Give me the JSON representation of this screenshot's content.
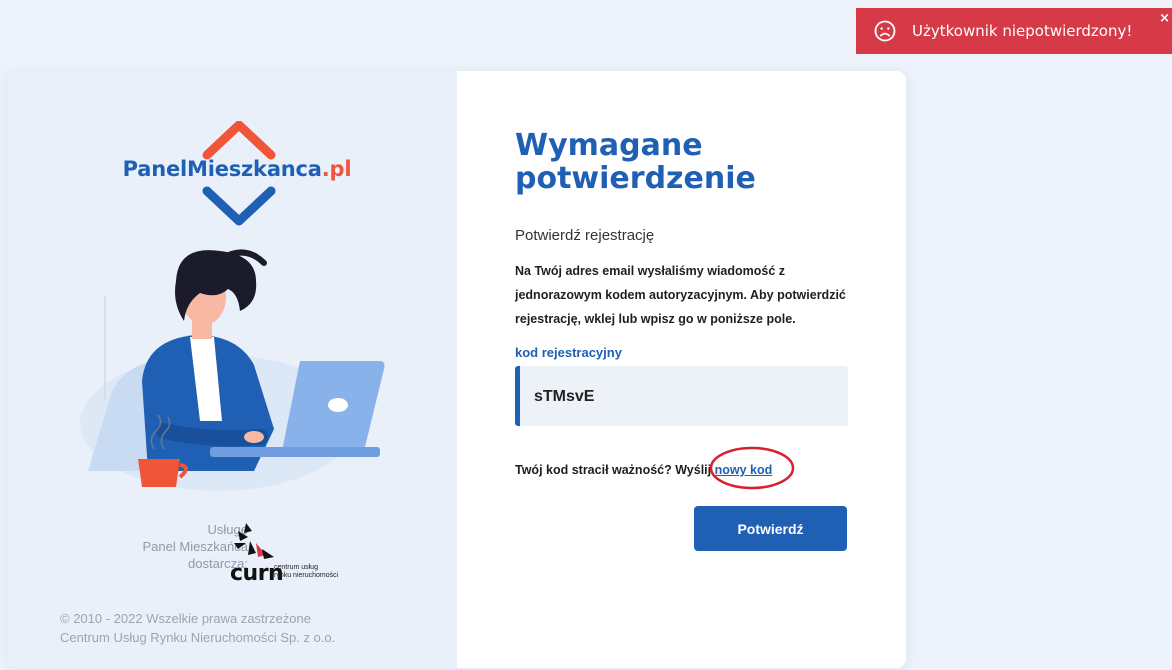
{
  "toast": {
    "message": "Użytkownik niepotwierdzony!",
    "close_symbol": "×",
    "icon": "sad-face-icon",
    "color": "#d63a47"
  },
  "brand": {
    "logo_main": "PanelMieszkanca",
    "logo_suffix": ".pl",
    "primary_color": "#1f5fb4",
    "accent_color": "#f0553a"
  },
  "credits": {
    "line1": "Usługę",
    "line2": "Panel Mieszkańca",
    "line3": "dostarcza:",
    "provider_logo": "curn",
    "provider_sub1": "centrum usług",
    "provider_sub2": "rynku nieruchomości"
  },
  "copyright": {
    "line1": "© 2010 - 2022 Wszelkie prawa zastrzeżone",
    "line2": "Centrum Usług Rynku Nieruchomości Sp. z o.o."
  },
  "form": {
    "title_line1": "Wymagane",
    "title_line2": "potwierdzenie",
    "subtitle": "Potwierdź rejestrację",
    "description": "Na Twój adres email wysłaliśmy wiadomość z jednorazowym kodem autoryzacyjnym. Aby potwierdzić rejestrację, wklej lub wpisz go w poniższe pole.",
    "code_label": "kod rejestracyjny",
    "code_value": "sTMsvE",
    "expired_text": "Twój kod stracił ważność? Wyślij",
    "new_code_link": "nowy kod",
    "confirm_button": "Potwierdź"
  }
}
